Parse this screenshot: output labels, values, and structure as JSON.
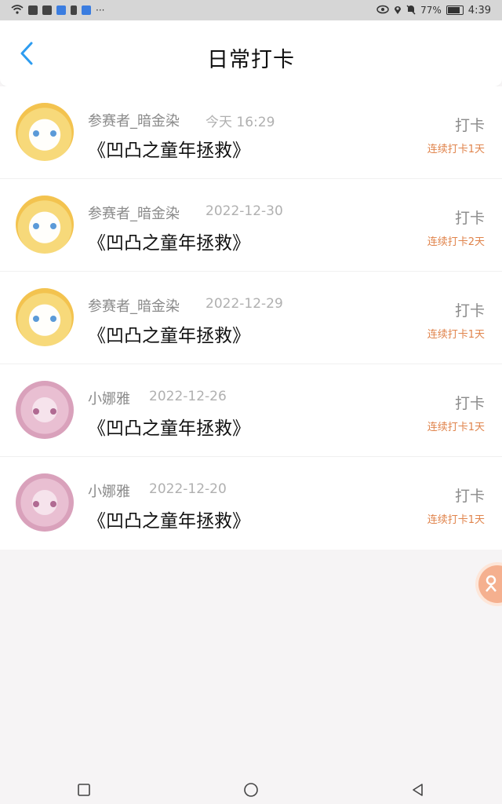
{
  "status_bar": {
    "left_icons": [
      "wifi-icon",
      "app-icon",
      "app-icon",
      "app-icon",
      "app-icon",
      "app-icon"
    ],
    "more": "···",
    "battery_text": "77%",
    "time": "4:39"
  },
  "header": {
    "title": "日常打卡",
    "back_icon": "chevron-left-icon",
    "accent_color": "#2d9cf0"
  },
  "entries": [
    {
      "name": "参赛者_暗金染",
      "date": "今天 16:29",
      "book": "《凹凸之童年拯救》",
      "action": "打卡",
      "streak": "连续打卡1天",
      "avatar": "blonde"
    },
    {
      "name": "参赛者_暗金染",
      "date": "2022-12-30",
      "book": "《凹凸之童年拯救》",
      "action": "打卡",
      "streak": "连续打卡2天",
      "avatar": "blonde"
    },
    {
      "name": "参赛者_暗金染",
      "date": "2022-12-29",
      "book": "《凹凸之童年拯救》",
      "action": "打卡",
      "streak": "连续打卡1天",
      "avatar": "blonde"
    },
    {
      "name": "小娜雅",
      "date": "2022-12-26",
      "book": "《凹凸之童年拯救》",
      "action": "打卡",
      "streak": "连续打卡1天",
      "avatar": "pink"
    },
    {
      "name": "小娜雅",
      "date": "2022-12-20",
      "book": "《凹凸之童年拯救》",
      "action": "打卡",
      "streak": "连续打卡1天",
      "avatar": "pink"
    }
  ],
  "colors": {
    "streak": "#e0844c",
    "muted": "#8a8a8a",
    "float_button": "#f5b08f"
  },
  "nav": {
    "icons": [
      "square-icon",
      "circle-icon",
      "triangle-back-icon"
    ]
  }
}
